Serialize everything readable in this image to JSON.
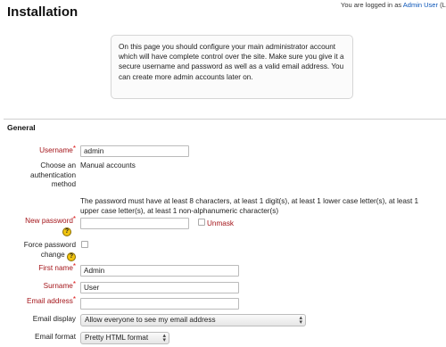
{
  "header": {
    "title": "Installation",
    "login_prefix": "You are logged in as ",
    "login_user": "Admin User",
    "login_suffix": " (Lo"
  },
  "notice": "On this page you should configure your main administrator account which will have complete control over the site. Make sure you give it a secure username and password as well as a valid email address. You can create more admin accounts later on.",
  "form": {
    "section_title": "General",
    "required_marker": "*",
    "help_glyph": "?",
    "username": {
      "label": "Username",
      "value": "admin"
    },
    "auth": {
      "label_line1": "Choose an",
      "label_line2": "authentication",
      "label_line3": "method",
      "value": "Manual accounts"
    },
    "password_rules": "The password must have at least 8 characters, at least 1 digit(s), at least 1 lower case letter(s), at least 1 upper case letter(s), at least 1 non-alphanumeric character(s)",
    "new_password": {
      "label": "New password",
      "value": "",
      "unmask_label": "Unmask"
    },
    "force_password": {
      "label_line1": "Force password",
      "label_line2": "change"
    },
    "first_name": {
      "label": "First name",
      "value": "Admin"
    },
    "surname": {
      "label": "Surname",
      "value": "User"
    },
    "email": {
      "label": "Email address",
      "value": ""
    },
    "email_display": {
      "label": "Email display",
      "selected": "Allow everyone to see my email address"
    },
    "email_format": {
      "label": "Email format",
      "selected": "Pretty HTML format"
    }
  }
}
